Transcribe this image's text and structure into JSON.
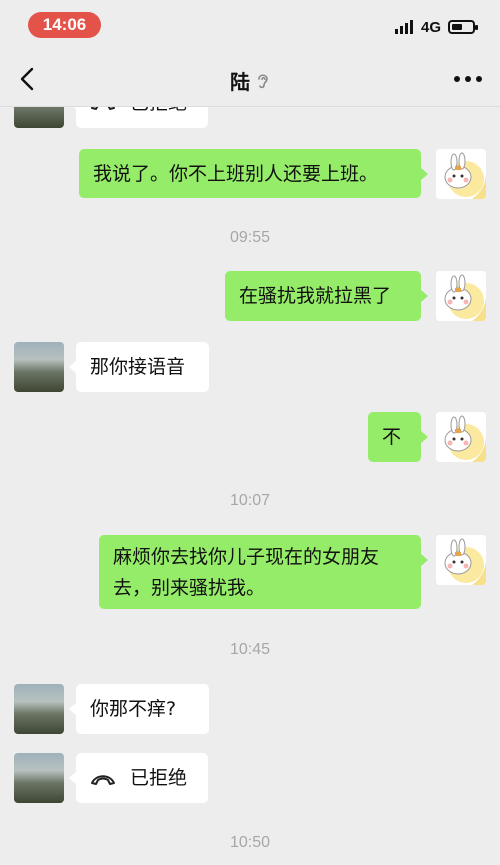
{
  "status_bar": {
    "time": "14:06",
    "network": "4G"
  },
  "header": {
    "title": "陆"
  },
  "messages": {
    "m0": {
      "text": "已拒绝"
    },
    "m1": {
      "text": "我说了。你不上班别人还要上班。"
    },
    "t1": "09:55",
    "m2": {
      "text": "在骚扰我就拉黑了"
    },
    "m3": {
      "text": "那你接语音"
    },
    "m4": {
      "text": "不"
    },
    "t2": "10:07",
    "m5": {
      "line1": "麻烦你去找你儿子现在的女朋友",
      "line2": "去，别来骚扰我。"
    },
    "t3": "10:45",
    "m6": {
      "text": "你那不痒?"
    },
    "m7": {
      "text": "已拒绝"
    },
    "t4": "10:50"
  },
  "colors": {
    "self_bubble": "#95ec69",
    "other_bubble": "#ffffff",
    "background": "#ededed",
    "time_pill": "#e4534a"
  },
  "icons": [
    "back-arrow-icon",
    "ear-icon",
    "more-icon",
    "phone-declined-icon",
    "signal-icon",
    "battery-icon"
  ]
}
